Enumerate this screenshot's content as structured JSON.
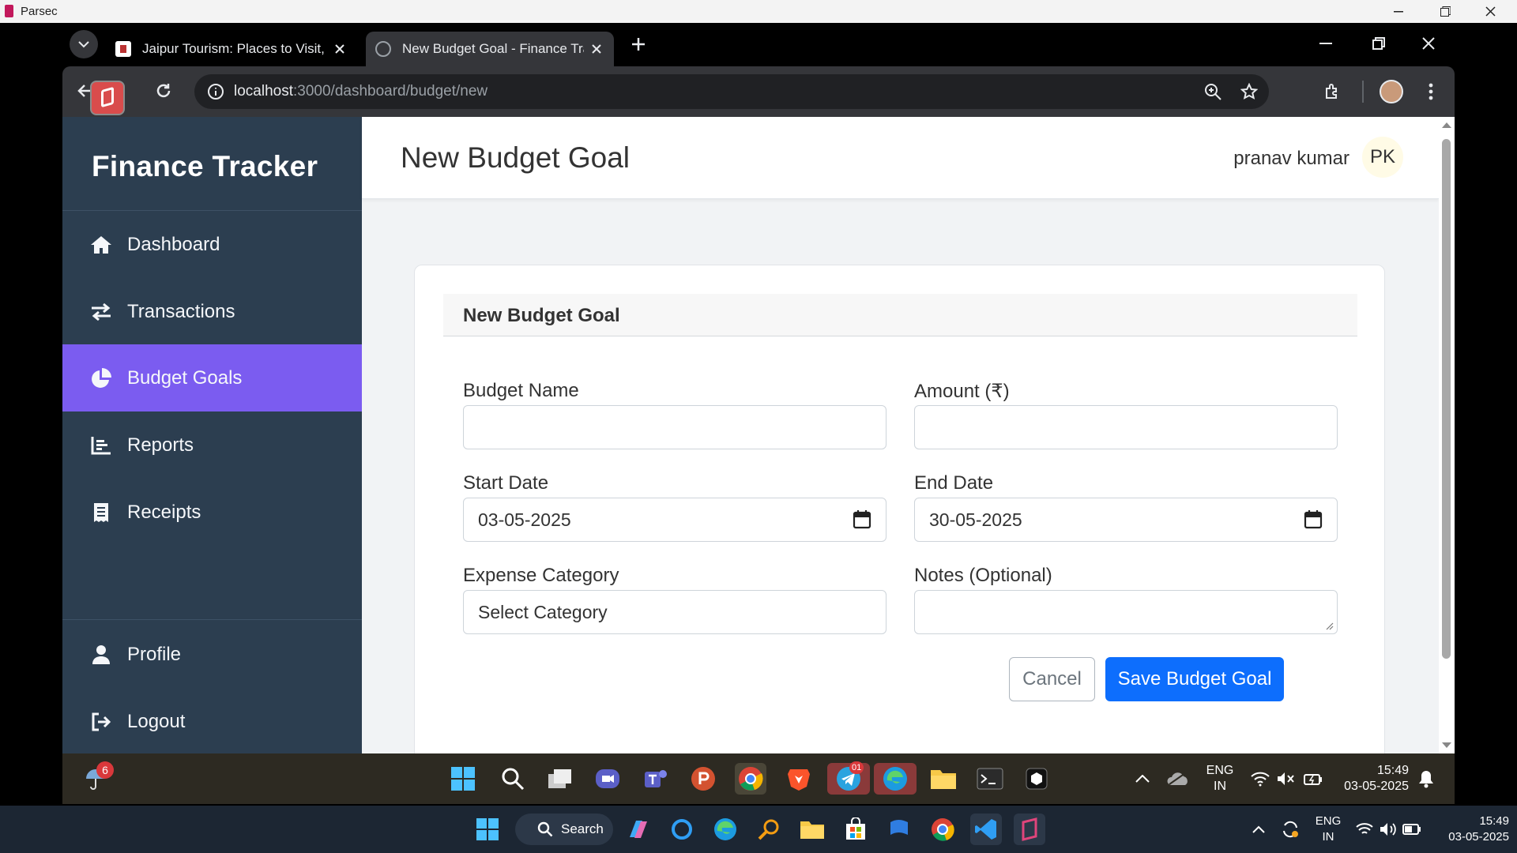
{
  "parsec": {
    "title": "Parsec"
  },
  "browser": {
    "tabs": [
      {
        "title": "Jaipur Tourism: Places to Visit, S",
        "active": false
      },
      {
        "title": "New Budget Goal - Finance Tra",
        "active": true
      }
    ],
    "url_host": "localhost",
    "url_path": ":3000/dashboard/budget/new"
  },
  "sidebar": {
    "brand": "Finance Tracker",
    "items": [
      {
        "label": "Dashboard",
        "icon": "home-icon"
      },
      {
        "label": "Transactions",
        "icon": "transfer-icon"
      },
      {
        "label": "Budget Goals",
        "icon": "pie-chart-icon",
        "active": true
      },
      {
        "label": "Reports",
        "icon": "bar-chart-icon"
      },
      {
        "label": "Receipts",
        "icon": "receipt-icon"
      }
    ],
    "bottom_items": [
      {
        "label": "Profile",
        "icon": "user-icon"
      },
      {
        "label": "Logout",
        "icon": "logout-icon"
      }
    ]
  },
  "header": {
    "title": "New Budget Goal",
    "user_name": "pranav kumar",
    "avatar_initials": "PK"
  },
  "form": {
    "card_title": "New Budget Goal",
    "budget_name_label": "Budget Name",
    "budget_name_value": "",
    "amount_label": "Amount (₹)",
    "amount_value": "",
    "start_date_label": "Start Date",
    "start_date_value": "03-05-2025",
    "end_date_label": "End Date",
    "end_date_value": "30-05-2025",
    "category_label": "Expense Category",
    "category_value": "Select Category",
    "notes_label": "Notes (Optional)",
    "notes_value": "",
    "cancel_label": "Cancel",
    "save_label": "Save Budget Goal"
  },
  "remote_taskbar": {
    "weather_badge": "6",
    "telegram_badge": "01",
    "lang_1": "ENG",
    "lang_2": "IN",
    "time": "15:49",
    "date": "03-05-2025"
  },
  "local_taskbar": {
    "search_label": "Search",
    "lang_1": "ENG",
    "lang_2": "IN",
    "time": "15:49",
    "date": "03-05-2025"
  },
  "colors": {
    "sidebar": "#2c3e50",
    "active_nav": "#7b5cf0",
    "primary": "#0d6efd"
  }
}
